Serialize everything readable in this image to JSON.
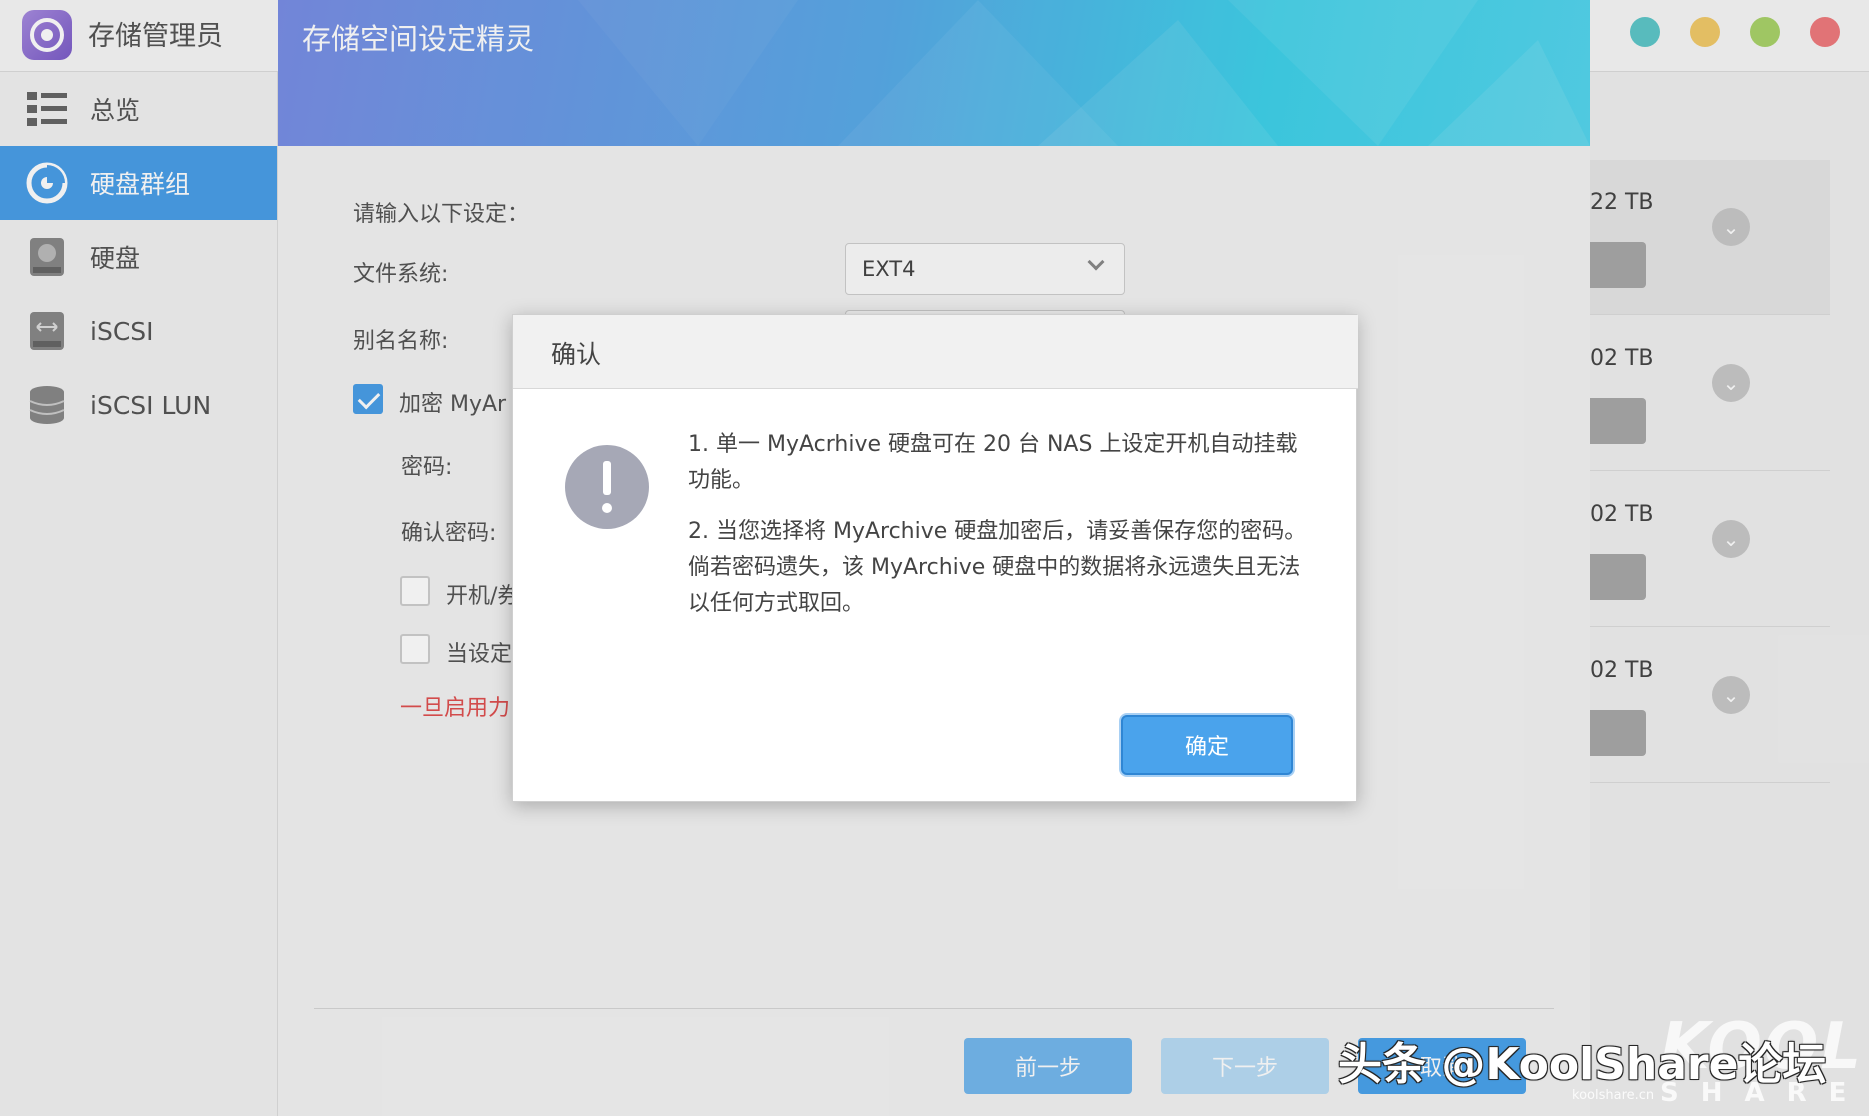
{
  "app": {
    "title": "存储管理员"
  },
  "window_controls": {
    "colors": [
      "#5ec7c9",
      "#f2ca6a",
      "#a9d36a",
      "#f07b7e"
    ]
  },
  "sidebar": {
    "items": [
      {
        "label": "总览",
        "icon": "overview-list-icon",
        "active": false
      },
      {
        "label": "硬盘群组",
        "icon": "disk-group-icon",
        "active": true
      },
      {
        "label": "硬盘",
        "icon": "hard-disk-icon",
        "active": false
      },
      {
        "label": "iSCSI",
        "icon": "iscsi-icon",
        "active": false
      },
      {
        "label": "iSCSI LUN",
        "icon": "iscsi-lun-icon",
        "active": false
      }
    ]
  },
  "background_list": {
    "rows": [
      {
        "size": "22 TB"
      },
      {
        "size": "02 TB"
      },
      {
        "size": "02 TB"
      },
      {
        "size": "02 TB"
      }
    ]
  },
  "wizard": {
    "title": "存储空间设定精灵",
    "prompt": "请输入以下设定：",
    "filesystem_label": "文件系统:",
    "filesystem_value": "EXT4",
    "alias_label": "别名名称:",
    "encrypt_label": "加密 MyAr",
    "password_label": "密码:",
    "confirm_password_label": "确认密码:",
    "option1_label": "开机/券",
    "option2_label": "当设定",
    "warning_text": "一旦启用力",
    "buttons": {
      "prev": "前一步",
      "next": "下一步",
      "cancel": "取消"
    }
  },
  "dialog": {
    "title": "确认",
    "message1": "1. 单一 MyAcrhive 硬盘可在 20 台 NAS 上设定开机自动挂载功能。",
    "message2": "2. 当您选择将 MyArchive 硬盘加密后，请妥善保存您的密码。倘若密码遗失，该 MyArchive 硬盘中的数据将永远遗失且无法以任何方式取回。",
    "ok_label": "确定"
  },
  "watermark": {
    "text": "头条 @KoolShare论坛",
    "logo": "KOOL",
    "share": "SHARE",
    "site": "koolshare.cn"
  },
  "colors": {
    "accent": "#4a9fe8",
    "warning": "#e05050"
  }
}
